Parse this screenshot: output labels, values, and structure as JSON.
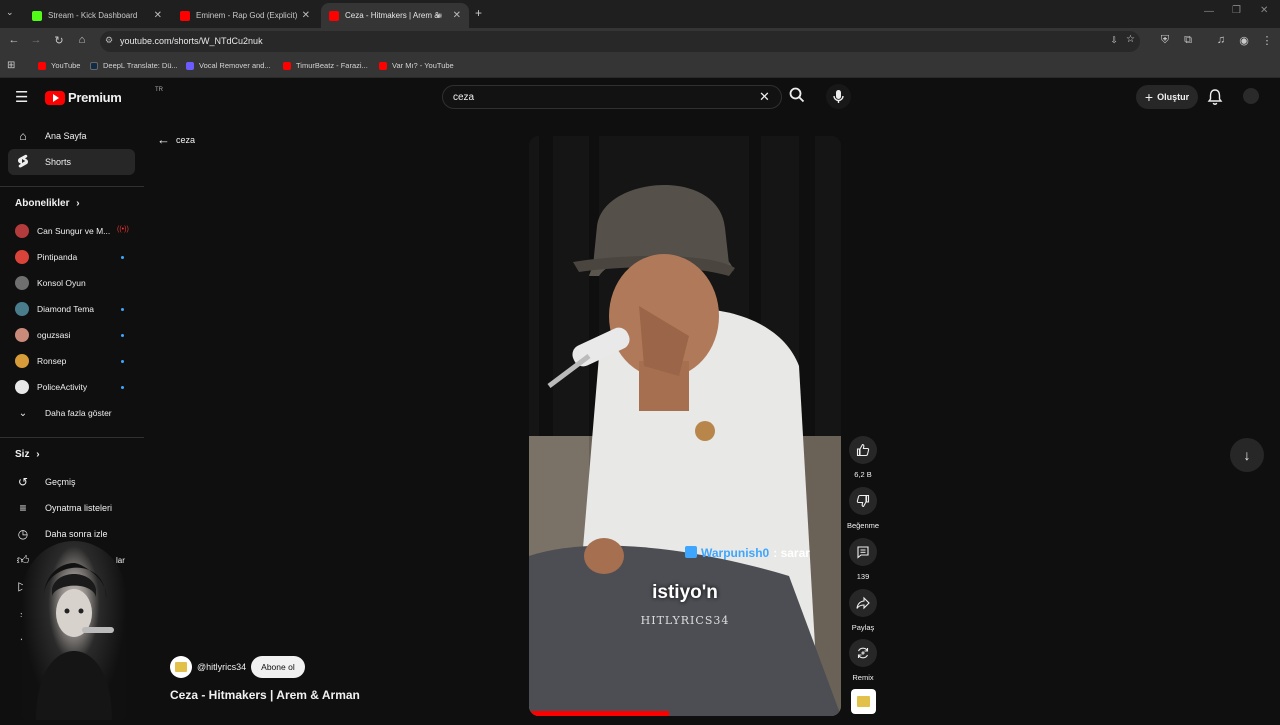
{
  "browser": {
    "tabs": [
      {
        "title": "Stream - Kick Dashboard",
        "favicon_color": "#53fc18",
        "active": false
      },
      {
        "title": "Eminem - Rap God (Explicit) - Y",
        "favicon_color": "#ff0000",
        "active": false
      },
      {
        "title": "Ceza - Hitmakers | Arem &",
        "favicon_color": "#ff0000",
        "active": true
      }
    ],
    "url": "youtube.com/shorts/W_NTdCu2nuk",
    "bookmarks": [
      {
        "label": "YouTube",
        "color": "#ff0000"
      },
      {
        "label": "DeepL Translate: Dü...",
        "color": "#0f2b46"
      },
      {
        "label": "Vocal Remover and...",
        "color": "#6b5cff"
      },
      {
        "label": "TimurBeatz - Farazi...",
        "color": "#ff0000"
      },
      {
        "label": "Var Mı? - YouTube",
        "color": "#ff0000"
      }
    ]
  },
  "youtube": {
    "logo_text": "Premium",
    "logo_tr": "TR",
    "search_query": "ceza",
    "create_label": "Oluştur",
    "sidebar": {
      "home": "Ana Sayfa",
      "shorts": "Shorts",
      "subs_title": "Abonelikler",
      "subscriptions": [
        {
          "name": "Can Sungur ve M...",
          "color": "#b43b3b",
          "badge": "live"
        },
        {
          "name": "Pintipanda",
          "color": "#d9443a"
        },
        {
          "name": "Konsol Oyun",
          "color": "#6f6f6f"
        },
        {
          "name": "Diamond Tema",
          "color": "#4a7d8c"
        },
        {
          "name": "oguzsasi",
          "color": "#c98a7a"
        },
        {
          "name": "Ronsep",
          "color": "#d89b3a"
        },
        {
          "name": "PoliceActivity",
          "color": "#e8e8e8"
        }
      ],
      "show_more": "Daha fazla göster",
      "you_title": "Siz",
      "you_items": [
        "Geçmiş",
        "Oynatma listeleri",
        "Daha sonra izle"
      ],
      "partial_label": "lar"
    },
    "back_label": "ceza",
    "video": {
      "caption": "istiyo'n",
      "watermark": "HITLYRICS34",
      "chat_name": "Warpunish0",
      "chat_text": ": sarar"
    },
    "channel": "@hitlyrics34",
    "subscribe_label": "Abone ol",
    "title": "Ceza - Hitmakers | Arem & Arman",
    "actions": {
      "likes": "6,2 B",
      "dislike_label": "Beğenme",
      "comments": "139",
      "share_label": "Paylaş",
      "remix_label": "Remix"
    }
  }
}
